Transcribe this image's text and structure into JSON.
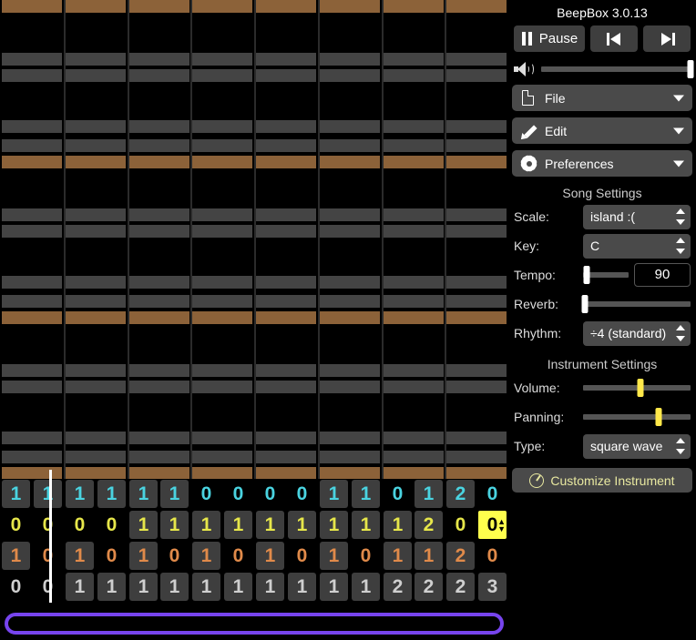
{
  "app": {
    "title": "BeepBox 3.0.13"
  },
  "transport": {
    "pause_label": "Pause",
    "pause_icon": "pause-icon",
    "prev_bar_icon": "skip-previous-icon",
    "next_bar_icon": "skip-next-icon",
    "volume_icon": "speaker-icon",
    "volume_value": 100
  },
  "menus": [
    {
      "label": "File",
      "icon": "file-icon",
      "caret": "chevron-down-icon"
    },
    {
      "label": "Edit",
      "icon": "pencil-icon",
      "caret": "chevron-down-icon"
    },
    {
      "label": "Preferences",
      "icon": "gear-icon",
      "caret": "chevron-down-icon"
    }
  ],
  "song_settings": {
    "heading": "Song Settings",
    "scale": {
      "label": "Scale:",
      "value": "island :("
    },
    "key": {
      "label": "Key:",
      "value": "C"
    },
    "tempo": {
      "label": "Tempo:",
      "value": "90",
      "slider_pct": 8
    },
    "reverb": {
      "label": "Reverb:",
      "slider_pct": 2
    },
    "rhythm": {
      "label": "Rhythm:",
      "value": "÷4 (standard)"
    }
  },
  "instrument_settings": {
    "heading": "Instrument Settings",
    "volume": {
      "label": "Volume:",
      "slider_pct": 53
    },
    "panning": {
      "label": "Panning:",
      "slider_pct": 70
    },
    "type": {
      "label": "Type:",
      "value": "square wave"
    },
    "customize": {
      "label": "Customize Instrument",
      "icon": "knob-icon"
    }
  },
  "colors": {
    "octave_band": "#8c6239",
    "scale_band": "#444444",
    "background": "#000000",
    "channel_pitch1": "#4ad3e0",
    "channel_pitch2": "#e6e64a",
    "channel_pitch3": "#e08a4a",
    "channel_noise": "#cfcfcf",
    "selected_cell": "#ffff4d",
    "loop_bar": "#7744ee",
    "playhead": "#ffffff",
    "menu_button": "#4a4a4a"
  },
  "track_grid": {
    "columns": 16,
    "selected": {
      "row": 1,
      "col": 15
    },
    "playhead_col_fraction": 1.55,
    "rows": [
      {
        "name": "pitch-channel-1",
        "color": "#4ad3e0",
        "cells": [
          "1",
          "1",
          "1",
          "1",
          "1",
          "1",
          "0",
          "0",
          "0",
          "0",
          "1",
          "1",
          "0",
          "1",
          "2",
          "0"
        ]
      },
      {
        "name": "pitch-channel-2",
        "color": "#e6e64a",
        "cells": [
          "0",
          "0",
          "0",
          "0",
          "1",
          "1",
          "1",
          "1",
          "1",
          "1",
          "1",
          "1",
          "1",
          "2",
          "0",
          "0"
        ]
      },
      {
        "name": "pitch-channel-3",
        "color": "#e08a4a",
        "cells": [
          "1",
          "0",
          "1",
          "0",
          "1",
          "0",
          "1",
          "0",
          "1",
          "0",
          "1",
          "0",
          "1",
          "1",
          "2",
          "0"
        ]
      },
      {
        "name": "noise-channel-1",
        "color": "#cfcfcf",
        "cells": [
          "0",
          "0",
          "1",
          "1",
          "1",
          "1",
          "1",
          "1",
          "1",
          "1",
          "1",
          "1",
          "2",
          "2",
          "2",
          "3"
        ]
      }
    ]
  },
  "pattern_editor": {
    "name": "piano-roll",
    "column_count": 8,
    "octave_row_tops": [
      0,
      171,
      342,
      496
    ],
    "scale_row_tops": [
      58,
      76,
      132,
      153,
      229,
      247,
      303,
      324,
      400,
      418,
      474,
      495
    ]
  },
  "loop_bar": {
    "name": "song-loop-bar"
  }
}
